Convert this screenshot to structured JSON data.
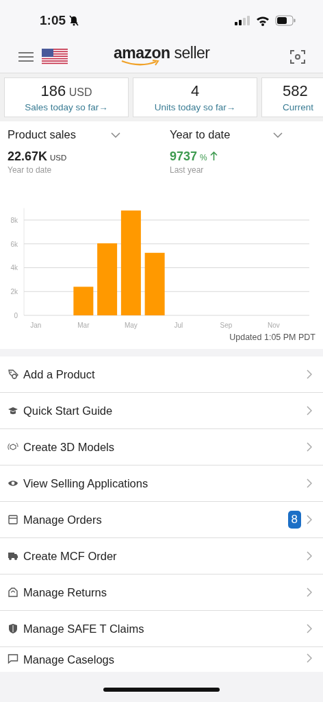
{
  "status_bar": {
    "time": "1:05"
  },
  "header": {
    "logo": "**amazon** seller"
  },
  "cards": [
    {
      "value": "186",
      "unit": "USD",
      "link": "Sales today so far→"
    },
    {
      "value": "4",
      "link": "Units today so far→"
    },
    {
      "value": "582",
      "link": "Current",
      "partial": true
    }
  ],
  "summary": {
    "metric_dropdown": "Product sales",
    "metric_value": "22.67K",
    "metric_unit": "USD",
    "metric_caption": "Year to date",
    "period_dropdown": "Year to date",
    "change_value": "9737",
    "change_unit": "%",
    "change_caption": "Last year"
  },
  "chart_data": {
    "type": "bar",
    "categories": [
      "Jan",
      null,
      "Mar",
      null,
      "May",
      null,
      "Jul",
      null,
      "Sep",
      null,
      "Nov",
      null
    ],
    "series": [
      {
        "color": "#ff9900",
        "values": [
          0,
          0,
          2400,
          6050,
          8800,
          5250,
          null,
          null,
          null,
          null,
          null,
          null
        ]
      }
    ],
    "grid": true,
    "ylim": [
      0,
      9000
    ],
    "yticks": [
      {
        "value": 0,
        "label": "0"
      },
      {
        "value": 2000,
        "label": "2k"
      },
      {
        "value": 4000,
        "label": "4k"
      },
      {
        "value": 6000,
        "label": "6k"
      },
      {
        "value": 8000,
        "label": "8k"
      }
    ]
  },
  "updated": "Updated 1:05 PM PDT",
  "menu": [
    {
      "label": "Add a Product"
    },
    {
      "label": "Quick Start Guide"
    },
    {
      "label": "Create 3D Models"
    },
    {
      "label": "View Selling Applications"
    },
    {
      "label": "Manage Orders",
      "badge": "8"
    },
    {
      "label": "Create MCF Order"
    },
    {
      "label": "Manage Returns"
    },
    {
      "label": "Manage SAFE T Claims"
    },
    {
      "label": "Manage Caselogs"
    }
  ]
}
